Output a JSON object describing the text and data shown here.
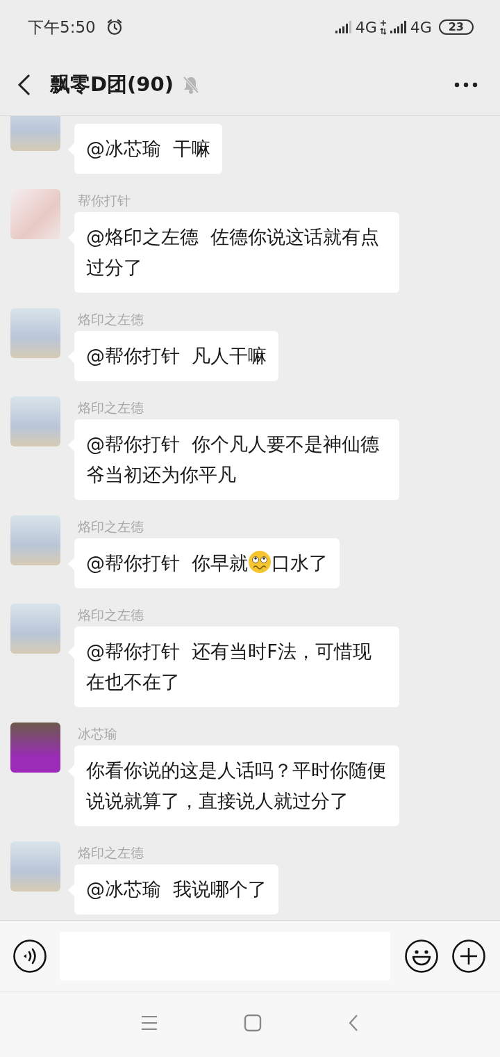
{
  "status_bar": {
    "time": "下午5:50",
    "network_1": "4G",
    "network_2": "4G",
    "battery": "23"
  },
  "header": {
    "title": "飘零D团(90)",
    "muted": true
  },
  "messages": [
    {
      "kind": "toy",
      "text": "@冰芯瑜  干嘛"
    },
    {
      "kind": "child",
      "sender": "帮你打针",
      "text": "@烙印之左德  佐德你说这话就有点过分了"
    },
    {
      "kind": "toy",
      "sender": "烙印之左德",
      "text": "@帮你打针  凡人干嘛"
    },
    {
      "kind": "toy",
      "sender": "烙印之左德",
      "text": "@帮你打针  你个凡人要不是神仙德爷当初还为你平凡"
    },
    {
      "kind": "toy",
      "sender": "烙印之左德",
      "parts": [
        {
          "kind": "text",
          "text": "@帮你打针  你早就"
        },
        {
          "kind": "emoji"
        },
        {
          "kind": "text",
          "text": "口水了"
        }
      ]
    },
    {
      "kind": "toy",
      "sender": "烙印之左德",
      "text": "@帮你打针  还有当时F法，可惜现在也不在了"
    },
    {
      "kind": "person",
      "sender": "冰芯瑜",
      "text": "你看你说的这是人话吗？平时你随便说说就算了，直接说人就过分了"
    },
    {
      "kind": "toy",
      "sender": "烙印之左德",
      "text": "@冰芯瑜  我说哪个了"
    }
  ]
}
